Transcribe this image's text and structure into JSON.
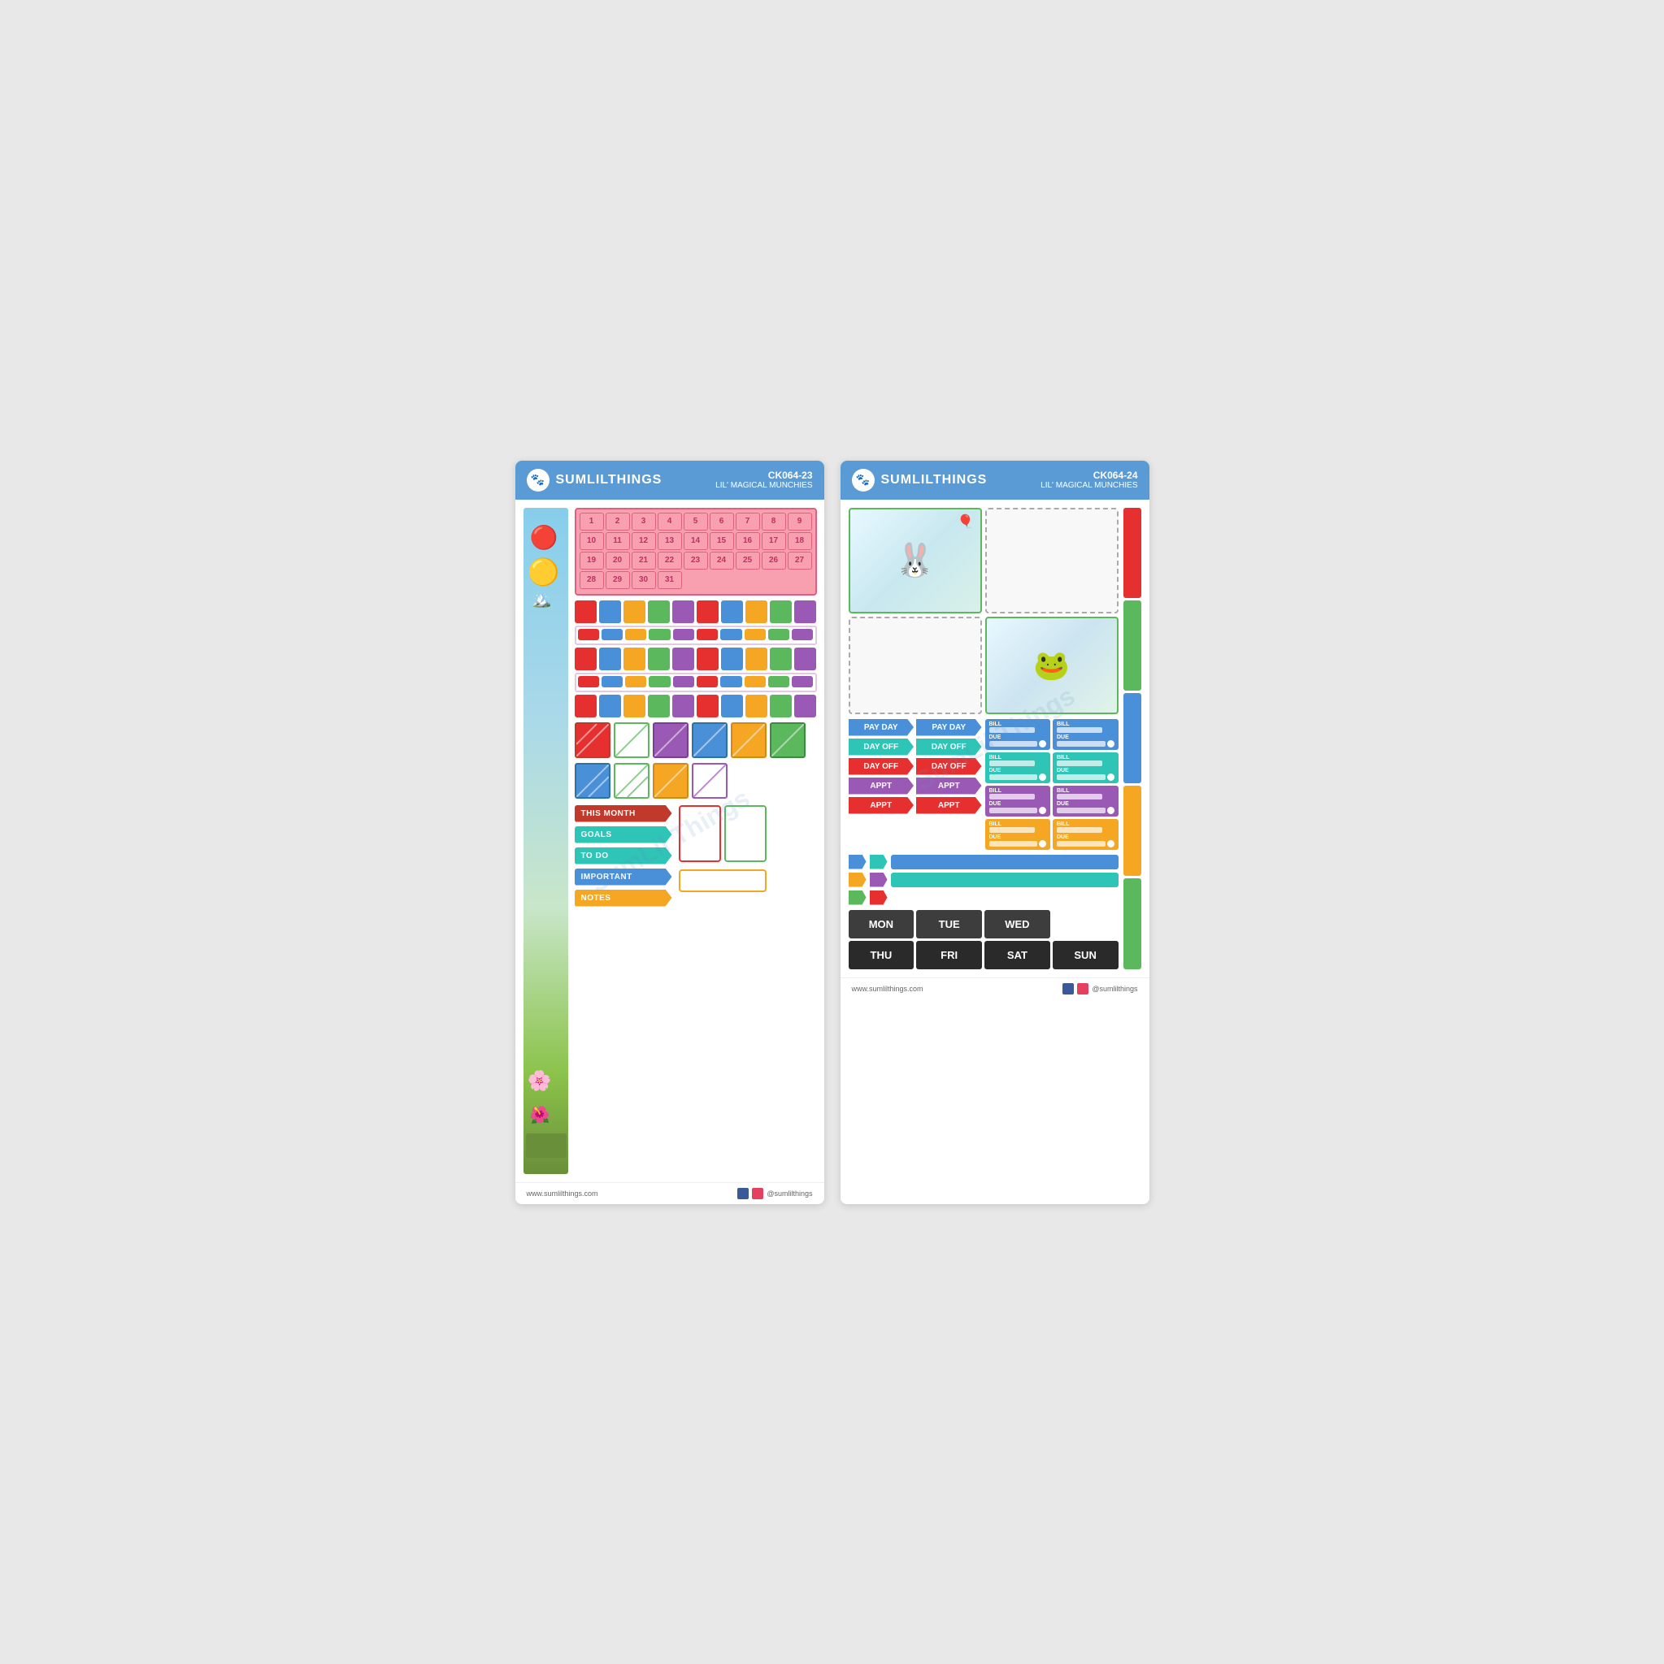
{
  "sheet1": {
    "header": {
      "brand": "SUMLILTHINGS",
      "code": "CK064-23",
      "subtitle": "LIL' MAGICAL MUNCHIES"
    },
    "numbers": {
      "row1": [
        1,
        2,
        3,
        4,
        5,
        6,
        7,
        8,
        9
      ],
      "row2": [
        10,
        11,
        12,
        13,
        14,
        15,
        16,
        17,
        18
      ],
      "row3": [
        19,
        20,
        21,
        22,
        23,
        24,
        25,
        26,
        27
      ],
      "row4": [
        28,
        29,
        30,
        31
      ]
    },
    "labels": {
      "this_month": "THIS MONTH",
      "goals": "GOALS",
      "to_do": "TO DO",
      "important": "IMPORTANT",
      "notes": "NOTES"
    },
    "colors": {
      "red": "#e63030",
      "blue": "#4a90d9",
      "orange": "#f5a623",
      "green": "#5cb85c",
      "purple": "#9b59b6",
      "teal": "#2ec4b6",
      "pink": "#e91e8c",
      "yellow": "#f5e623",
      "dark_red": "#c0392b",
      "label_this_month": "#c0392b",
      "label_goals": "#2ec4b6",
      "label_to_do": "#2ec4b6",
      "label_important": "#4a90d9",
      "label_notes": "#f5a623"
    },
    "footer": {
      "website": "www.sumlilthings.com",
      "social": "@sumlilthings"
    }
  },
  "sheet2": {
    "header": {
      "brand": "SUMLILTHINGS",
      "code": "CK064-24",
      "subtitle": "LIL' MAGICAL MUNCHIES"
    },
    "event_labels": {
      "pay_day": "PAY DAY",
      "day_off": "DAY OFF",
      "appt": "APPT"
    },
    "bill_labels": {
      "bill": "BILL",
      "due": "DUE"
    },
    "days": {
      "mon": "MON",
      "tue": "TUE",
      "wed": "WED",
      "thu": "THU",
      "fri": "FRI",
      "sat": "SAT",
      "sun": "SUN"
    },
    "colors": {
      "blue": "#4a90d9",
      "teal": "#2ec4b6",
      "orange": "#f5a623",
      "red": "#e63030",
      "purple": "#9b59b6",
      "green": "#5cb85c",
      "pay_day": "#4a90d9",
      "day_off_teal": "#2ec4b6",
      "day_off_red": "#e63030",
      "appt_orange": "#f5a623",
      "appt_red": "#e63030",
      "days_dark": "#3d3d3d",
      "days_darker": "#2a2a2a"
    },
    "footer": {
      "website": "www.sumlilthings.com",
      "social": "@sumlilthings"
    }
  }
}
